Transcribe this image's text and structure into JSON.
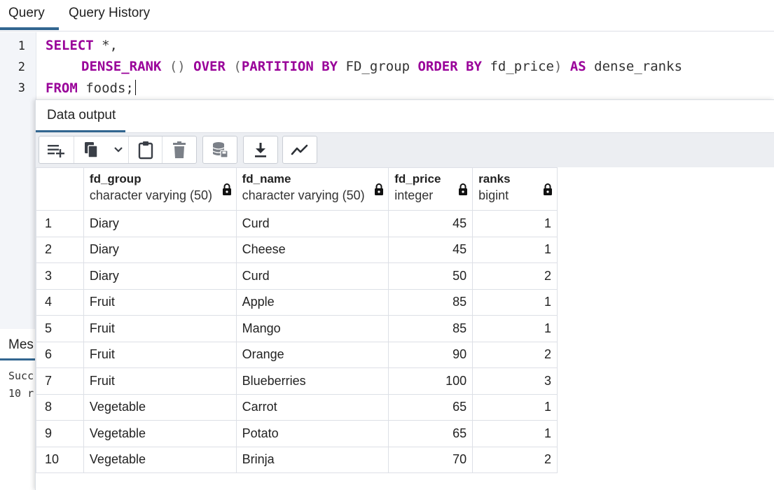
{
  "tabs": {
    "query": "Query",
    "history": "Query History"
  },
  "editor": {
    "line_numbers": [
      "1",
      "2",
      "3"
    ],
    "line1": {
      "kw": "SELECT",
      "rest": " *,"
    },
    "line2": {
      "kw1": "DENSE_RANK",
      "p1": " () ",
      "kw2": "OVER",
      "p2": " (",
      "kw3": "PARTITION BY",
      "id1": " FD_group ",
      "kw4": "ORDER BY",
      "id2": " fd_price",
      "p3": ") ",
      "kw5": "AS",
      "id3": " dense_ranks"
    },
    "line3": {
      "kw": "FROM",
      "rest": " foods;"
    }
  },
  "messages": {
    "tab": "Mes",
    "line1": "Succ",
    "line2": "10 r"
  },
  "output": {
    "title": "Data output",
    "toolbar_icons": [
      "add-row-icon",
      "copy-icon",
      "chevron-down-icon",
      "paste-icon",
      "delete-icon",
      "save-data-icon",
      "download-icon",
      "graph-icon"
    ],
    "columns": [
      {
        "name": "fd_group",
        "type": "character varying (50)"
      },
      {
        "name": "fd_name",
        "type": "character varying (50)"
      },
      {
        "name": "fd_price",
        "type": "integer"
      },
      {
        "name": "ranks",
        "type": "bigint"
      }
    ],
    "rows": [
      {
        "idx": "1",
        "fd_group": "Diary",
        "fd_name": "Curd",
        "fd_price": "45",
        "ranks": "1"
      },
      {
        "idx": "2",
        "fd_group": "Diary",
        "fd_name": "Cheese",
        "fd_price": "45",
        "ranks": "1"
      },
      {
        "idx": "3",
        "fd_group": "Diary",
        "fd_name": "Curd",
        "fd_price": "50",
        "ranks": "2"
      },
      {
        "idx": "4",
        "fd_group": "Fruit",
        "fd_name": "Apple",
        "fd_price": "85",
        "ranks": "1"
      },
      {
        "idx": "5",
        "fd_group": "Fruit",
        "fd_name": "Mango",
        "fd_price": "85",
        "ranks": "1"
      },
      {
        "idx": "6",
        "fd_group": "Fruit",
        "fd_name": "Orange",
        "fd_price": "90",
        "ranks": "2"
      },
      {
        "idx": "7",
        "fd_group": "Fruit",
        "fd_name": "Blueberries",
        "fd_price": "100",
        "ranks": "3"
      },
      {
        "idx": "8",
        "fd_group": "Vegetable",
        "fd_name": "Carrot",
        "fd_price": "65",
        "ranks": "1"
      },
      {
        "idx": "9",
        "fd_group": "Vegetable",
        "fd_name": "Potato",
        "fd_price": "65",
        "ranks": "1"
      },
      {
        "idx": "10",
        "fd_group": "Vegetable",
        "fd_name": "Brinja",
        "fd_price": "70",
        "ranks": "2"
      }
    ]
  },
  "colors": {
    "accent": "#326690",
    "keyword": "#990099"
  }
}
